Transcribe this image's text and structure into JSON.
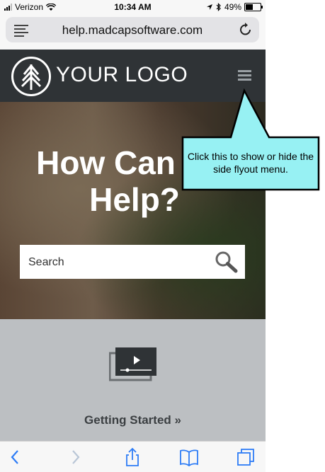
{
  "status_bar": {
    "carrier": "Verizon",
    "time": "10:34 AM",
    "battery": "49%",
    "battery_level": 0.49
  },
  "browser": {
    "url": "help.madcapsoftware.com",
    "reader_icon": "reader-mode-icon",
    "reload_icon": "reload-icon"
  },
  "header": {
    "logo_text": "YOUR LOGO",
    "logo_icon": "tree-logo-icon",
    "menu_icon": "hamburger-menu-icon"
  },
  "hero": {
    "title": "How Can We Help?",
    "search_placeholder": "Search",
    "search_icon": "search-icon"
  },
  "section": {
    "icon": "video-icon",
    "link_label": "Getting Started »"
  },
  "callout": {
    "text": "Click this to show or hide the side flyout menu.",
    "fill": "#97f1f3"
  },
  "toolbar": {
    "items": [
      "back-icon",
      "forward-icon",
      "share-icon",
      "bookmarks-icon",
      "tabs-icon"
    ]
  },
  "colors": {
    "header_bg": "#2f3336",
    "gray_section": "#bcbfc2",
    "ios_blue": "#2d7cf6"
  }
}
